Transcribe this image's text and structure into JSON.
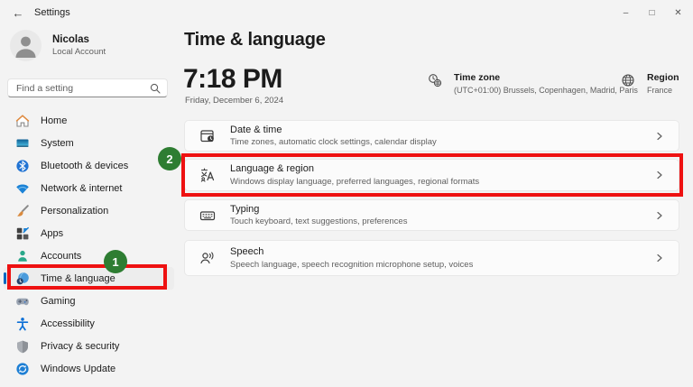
{
  "window": {
    "title": "Settings",
    "back_glyph": "←",
    "controls": {
      "minimize": "–",
      "maximize": "□",
      "close": "✕"
    }
  },
  "sidebar": {
    "user": {
      "name": "Nicolas",
      "subtitle": "Local Account"
    },
    "search": {
      "placeholder": "Find a setting"
    },
    "items": [
      {
        "label": "Home",
        "icon": "home-icon"
      },
      {
        "label": "System",
        "icon": "system-icon"
      },
      {
        "label": "Bluetooth & devices",
        "icon": "bluetooth-icon"
      },
      {
        "label": "Network & internet",
        "icon": "network-icon"
      },
      {
        "label": "Personalization",
        "icon": "personalization-icon"
      },
      {
        "label": "Apps",
        "icon": "apps-icon"
      },
      {
        "label": "Accounts",
        "icon": "accounts-icon"
      },
      {
        "label": "Time & language",
        "icon": "time-language-icon",
        "selected": true
      },
      {
        "label": "Gaming",
        "icon": "gaming-icon"
      },
      {
        "label": "Accessibility",
        "icon": "accessibility-icon"
      },
      {
        "label": "Privacy & security",
        "icon": "privacy-icon"
      },
      {
        "label": "Windows Update",
        "icon": "windows-update-icon"
      }
    ]
  },
  "main": {
    "title": "Time & language",
    "clock": {
      "time": "7:18 PM",
      "date": "Friday, December 6, 2024"
    },
    "timezone": {
      "label": "Time zone",
      "value": "(UTC+01:00) Brussels, Copenhagen, Madrid, Paris"
    },
    "region": {
      "label": "Region",
      "value": "France"
    },
    "rows": [
      {
        "title": "Date & time",
        "subtitle": "Time zones, automatic clock settings, calendar display"
      },
      {
        "title": "Language & region",
        "subtitle": "Windows display language, preferred languages, regional formats",
        "highlighted": true
      },
      {
        "title": "Typing",
        "subtitle": "Touch keyboard, text suggestions, preferences"
      },
      {
        "title": "Speech",
        "subtitle": "Speech language, speech recognition microphone setup, voices"
      }
    ]
  },
  "annotations": {
    "step1": "1",
    "step2": "2",
    "highlight_color": "#ee1111",
    "badge_color": "#2e7d32"
  }
}
